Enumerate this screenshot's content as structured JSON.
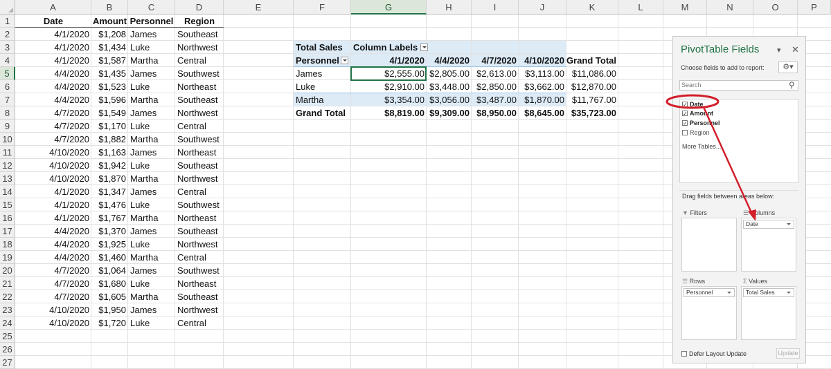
{
  "sheet": {
    "columns": [
      "A",
      "B",
      "C",
      "D",
      "E",
      "F",
      "G",
      "H",
      "I",
      "J",
      "K",
      "L",
      "M",
      "N",
      "O",
      "P"
    ],
    "rows": [
      "1",
      "2",
      "3",
      "4",
      "5",
      "6",
      "7",
      "8",
      "9",
      "10",
      "11",
      "12",
      "13",
      "14",
      "15",
      "16",
      "17",
      "18",
      "19",
      "20",
      "21",
      "22",
      "23",
      "24",
      "25",
      "26",
      "27"
    ],
    "table": {
      "headers": [
        "Date",
        "Amount",
        "Personnel",
        "Region"
      ],
      "rows": [
        [
          "4/1/2020",
          "$1,208",
          "James",
          "Southeast"
        ],
        [
          "4/1/2020",
          "$1,434",
          "Luke",
          "Northwest"
        ],
        [
          "4/1/2020",
          "$1,587",
          "Martha",
          "Central"
        ],
        [
          "4/4/2020",
          "$1,435",
          "James",
          "Southwest"
        ],
        [
          "4/4/2020",
          "$1,523",
          "Luke",
          "Northeast"
        ],
        [
          "4/4/2020",
          "$1,596",
          "Martha",
          "Southeast"
        ],
        [
          "4/7/2020",
          "$1,549",
          "James",
          "Northwest"
        ],
        [
          "4/7/2020",
          "$1,170",
          "Luke",
          "Central"
        ],
        [
          "4/7/2020",
          "$1,882",
          "Martha",
          "Southwest"
        ],
        [
          "4/10/2020",
          "$1,163",
          "James",
          "Northeast"
        ],
        [
          "4/10/2020",
          "$1,942",
          "Luke",
          "Southeast"
        ],
        [
          "4/10/2020",
          "$1,870",
          "Martha",
          "Northwest"
        ],
        [
          "4/1/2020",
          "$1,347",
          "James",
          "Central"
        ],
        [
          "4/1/2020",
          "$1,476",
          "Luke",
          "Southwest"
        ],
        [
          "4/1/2020",
          "$1,767",
          "Martha",
          "Northeast"
        ],
        [
          "4/4/2020",
          "$1,370",
          "James",
          "Southeast"
        ],
        [
          "4/4/2020",
          "$1,925",
          "Luke",
          "Northwest"
        ],
        [
          "4/4/2020",
          "$1,460",
          "Martha",
          "Central"
        ],
        [
          "4/7/2020",
          "$1,064",
          "James",
          "Southwest"
        ],
        [
          "4/7/2020",
          "$1,680",
          "Luke",
          "Northeast"
        ],
        [
          "4/7/2020",
          "$1,605",
          "Martha",
          "Southeast"
        ],
        [
          "4/10/2020",
          "$1,950",
          "James",
          "Northwest"
        ],
        [
          "4/10/2020",
          "$1,720",
          "Luke",
          "Central"
        ]
      ]
    },
    "pivot": {
      "value_label": "Total Sales",
      "column_labels": "Column Labels",
      "row_header": "Personnel",
      "col_headers": [
        "4/1/2020",
        "4/4/2020",
        "4/7/2020",
        "4/10/2020",
        "Grand Total"
      ],
      "rows": [
        {
          "name": "James",
          "values": [
            "$2,555.00",
            "$2,805.00",
            "$2,613.00",
            "$3,113.00",
            "$11,086.00"
          ]
        },
        {
          "name": "Luke",
          "values": [
            "$2,910.00",
            "$3,448.00",
            "$2,850.00",
            "$3,662.00",
            "$12,870.00"
          ]
        },
        {
          "name": "Martha",
          "values": [
            "$3,354.00",
            "$3,056.00",
            "$3,487.00",
            "$1,870.00",
            "$11,767.00"
          ]
        }
      ],
      "total_label": "Grand Total",
      "totals": [
        "$8,819.00",
        "$9,309.00",
        "$8,950.00",
        "$8,645.00",
        "$35,723.00"
      ]
    }
  },
  "panel": {
    "title": "PivotTable Fields",
    "subtitle": "Choose fields to add to report:",
    "search_placeholder": "Search",
    "fields": [
      {
        "label": "Date",
        "checked": true
      },
      {
        "label": "Amount",
        "checked": true
      },
      {
        "label": "Personnel",
        "checked": true
      },
      {
        "label": "Region",
        "checked": false
      }
    ],
    "more_tables": "More Tables...",
    "drag_hint": "Drag fields between areas below:",
    "areas": {
      "filters": "Filters",
      "columns": "Columns",
      "rows": "Rows",
      "values": "Values"
    },
    "columns_item": "Date",
    "rows_item": "Personnel",
    "values_item": "Total Sales",
    "defer": "Defer Layout Update",
    "update": "Update",
    "accent": "#217346",
    "annotation_color": "#d21f2a"
  }
}
